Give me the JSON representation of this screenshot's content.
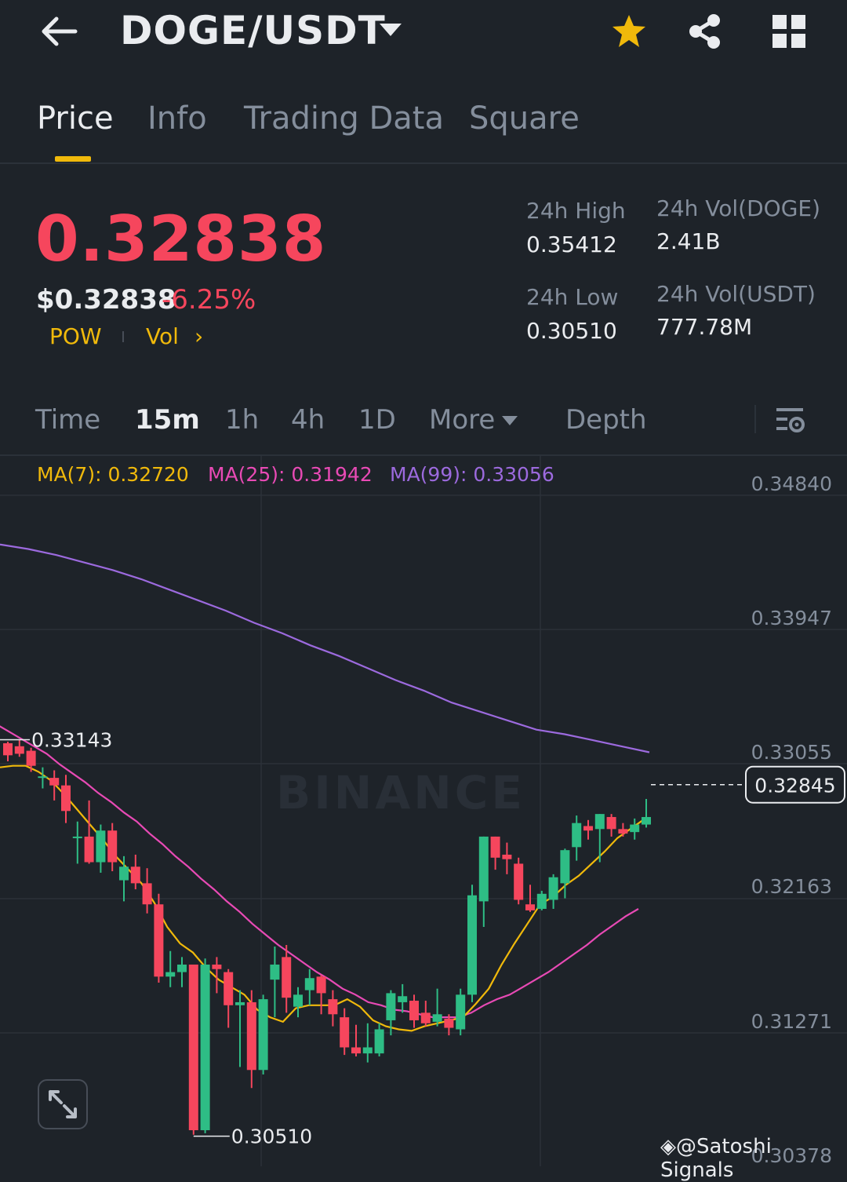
{
  "header": {
    "pair": "DOGE/USDT",
    "icons": [
      "back-arrow-icon",
      "chevron-down-icon",
      "star-icon",
      "share-icon",
      "grid-icon"
    ],
    "star_color": "#f0b90b"
  },
  "tabs": [
    {
      "label": "Price",
      "active": true
    },
    {
      "label": "Info",
      "active": false
    },
    {
      "label": "Trading Data",
      "active": false
    },
    {
      "label": "Square",
      "active": false
    }
  ],
  "ticker": {
    "last_price": "0.32838",
    "usd_price": "$0.32838",
    "change": "-6.25%",
    "tag_pow": "POW",
    "tag_vol": "Vol",
    "tag_arrow": "›",
    "high_label": "24h High",
    "high_value": "0.35412",
    "low_label": "24h Low",
    "low_value": "0.30510",
    "vol_doge_label": "24h Vol(DOGE)",
    "vol_doge_value": "2.41B",
    "vol_usdt_label": "24h Vol(USDT)",
    "vol_usdt_value": "777.78M",
    "down_color": "#f6465d",
    "up_color": "#2ebd85",
    "accent_color": "#f0b90b"
  },
  "intervals": {
    "time": "Time",
    "m15": "15m",
    "h1": "1h",
    "h4": "4h",
    "d1": "1D",
    "more": "More",
    "depth": "Depth",
    "active": "15m"
  },
  "indicators": {
    "ma7": "MA(7): 0.32720",
    "ma25": "MA(25): 0.31942",
    "ma99": "MA(99): 0.33056",
    "ma7_color": "#f0b90b",
    "ma25_color": "#e84ab5",
    "ma99_color": "#9c6ade"
  },
  "watermark": {
    "brand": "BINANCE",
    "credit": "@Satoshi Signals"
  },
  "chart_data": {
    "type": "candlestick",
    "y_axis_ticks": [
      "0.34840",
      "0.33947",
      "0.33055",
      "0.32163",
      "0.31271",
      "0.30378"
    ],
    "ylim": [
      0.30378,
      0.3484
    ],
    "current_price_label": "0.32845",
    "period_high_label": "0.33143",
    "period_low_label": "0.30510",
    "candles": [
      {
        "o": 0.3312,
        "h": 0.3313,
        "l": 0.33,
        "c": 0.3304
      },
      {
        "o": 0.331,
        "h": 0.3314,
        "l": 0.3303,
        "c": 0.3305
      },
      {
        "o": 0.3307,
        "h": 0.3309,
        "l": 0.3293,
        "c": 0.3297
      },
      {
        "o": 0.329,
        "h": 0.3296,
        "l": 0.3282,
        "c": 0.329
      },
      {
        "o": 0.3289,
        "h": 0.3294,
        "l": 0.3274,
        "c": 0.3284
      },
      {
        "o": 0.3284,
        "h": 0.3291,
        "l": 0.3259,
        "c": 0.3267
      },
      {
        "o": 0.325,
        "h": 0.326,
        "l": 0.3232,
        "c": 0.325
      },
      {
        "o": 0.325,
        "h": 0.3274,
        "l": 0.3232,
        "c": 0.3233
      },
      {
        "o": 0.3233,
        "h": 0.3258,
        "l": 0.3226,
        "c": 0.3254
      },
      {
        "o": 0.3254,
        "h": 0.3259,
        "l": 0.3227,
        "c": 0.3233
      },
      {
        "o": 0.3221,
        "h": 0.3237,
        "l": 0.3207,
        "c": 0.323
      },
      {
        "o": 0.323,
        "h": 0.3238,
        "l": 0.3215,
        "c": 0.3219
      },
      {
        "o": 0.3219,
        "h": 0.3229,
        "l": 0.3199,
        "c": 0.3205
      },
      {
        "o": 0.3205,
        "h": 0.3212,
        "l": 0.3153,
        "c": 0.3157
      },
      {
        "o": 0.3157,
        "h": 0.3174,
        "l": 0.315,
        "c": 0.316
      },
      {
        "o": 0.316,
        "h": 0.317,
        "l": 0.315,
        "c": 0.3165
      },
      {
        "o": 0.3165,
        "h": 0.3165,
        "l": 0.3052,
        "c": 0.3055
      },
      {
        "o": 0.3055,
        "h": 0.3169,
        "l": 0.3053,
        "c": 0.3165
      },
      {
        "o": 0.3165,
        "h": 0.317,
        "l": 0.3146,
        "c": 0.3162
      },
      {
        "o": 0.316,
        "h": 0.3162,
        "l": 0.3123,
        "c": 0.3138
      },
      {
        "o": 0.3138,
        "h": 0.3148,
        "l": 0.3097,
        "c": 0.314
      },
      {
        "o": 0.314,
        "h": 0.3148,
        "l": 0.3083,
        "c": 0.3095
      },
      {
        "o": 0.3095,
        "h": 0.3145,
        "l": 0.3092,
        "c": 0.3142
      },
      {
        "o": 0.3155,
        "h": 0.3177,
        "l": 0.313,
        "c": 0.3165
      },
      {
        "o": 0.317,
        "h": 0.3178,
        "l": 0.3133,
        "c": 0.3143
      },
      {
        "o": 0.3137,
        "h": 0.315,
        "l": 0.313,
        "c": 0.3145
      },
      {
        "o": 0.3148,
        "h": 0.3162,
        "l": 0.3138,
        "c": 0.3156
      },
      {
        "o": 0.3157,
        "h": 0.3158,
        "l": 0.3132,
        "c": 0.3146
      },
      {
        "o": 0.3142,
        "h": 0.3148,
        "l": 0.3124,
        "c": 0.3132
      },
      {
        "o": 0.313,
        "h": 0.3136,
        "l": 0.3105,
        "c": 0.311
      },
      {
        "o": 0.311,
        "h": 0.3125,
        "l": 0.3104,
        "c": 0.3106
      },
      {
        "o": 0.3106,
        "h": 0.3126,
        "l": 0.31,
        "c": 0.311
      },
      {
        "o": 0.3106,
        "h": 0.3126,
        "l": 0.3104,
        "c": 0.3122
      },
      {
        "o": 0.3128,
        "h": 0.3148,
        "l": 0.3118,
        "c": 0.3146
      },
      {
        "o": 0.314,
        "h": 0.3152,
        "l": 0.3133,
        "c": 0.3144
      },
      {
        "o": 0.3141,
        "h": 0.3145,
        "l": 0.3123,
        "c": 0.3128
      },
      {
        "o": 0.3133,
        "h": 0.3141,
        "l": 0.3124,
        "c": 0.3126
      },
      {
        "o": 0.3127,
        "h": 0.3149,
        "l": 0.3124,
        "c": 0.3132
      },
      {
        "o": 0.3129,
        "h": 0.3132,
        "l": 0.3118,
        "c": 0.3123
      },
      {
        "o": 0.3122,
        "h": 0.3149,
        "l": 0.3118,
        "c": 0.3145
      },
      {
        "o": 0.3145,
        "h": 0.3218,
        "l": 0.314,
        "c": 0.3211
      },
      {
        "o": 0.3207,
        "h": 0.325,
        "l": 0.319,
        "c": 0.325
      },
      {
        "o": 0.325,
        "h": 0.325,
        "l": 0.3228,
        "c": 0.3236
      },
      {
        "o": 0.3238,
        "h": 0.3246,
        "l": 0.3225,
        "c": 0.3235
      },
      {
        "o": 0.3232,
        "h": 0.3236,
        "l": 0.3205,
        "c": 0.3208
      },
      {
        "o": 0.3205,
        "h": 0.3218,
        "l": 0.32,
        "c": 0.3201
      },
      {
        "o": 0.3202,
        "h": 0.3214,
        "l": 0.3201,
        "c": 0.3212
      },
      {
        "o": 0.3208,
        "h": 0.3225,
        "l": 0.3202,
        "c": 0.3223
      },
      {
        "o": 0.3219,
        "h": 0.3242,
        "l": 0.3209,
        "c": 0.3241
      },
      {
        "o": 0.3243,
        "h": 0.3264,
        "l": 0.3234,
        "c": 0.3259
      },
      {
        "o": 0.3257,
        "h": 0.3261,
        "l": 0.3248,
        "c": 0.3254
      },
      {
        "o": 0.3255,
        "h": 0.3265,
        "l": 0.3233,
        "c": 0.3265
      },
      {
        "o": 0.3263,
        "h": 0.3265,
        "l": 0.325,
        "c": 0.3255
      },
      {
        "o": 0.3255,
        "h": 0.3259,
        "l": 0.325,
        "c": 0.3252
      },
      {
        "o": 0.3253,
        "h": 0.3262,
        "l": 0.3248,
        "c": 0.3258
      },
      {
        "o": 0.3258,
        "h": 0.3275,
        "l": 0.3256,
        "c": 0.3263
      }
    ],
    "ma7": [
      0.3296,
      0.3297,
      0.3297,
      0.3293,
      0.3287,
      0.3278,
      0.3268,
      0.3258,
      0.3248,
      0.3237,
      0.3228,
      0.3219,
      0.3206,
      0.319,
      0.3179,
      0.3173,
      0.3163,
      0.3155,
      0.315,
      0.3145,
      0.3135,
      0.313,
      0.3127,
      0.3136,
      0.3138,
      0.3138,
      0.3138,
      0.3142,
      0.3137,
      0.3128,
      0.3124,
      0.3122,
      0.3121,
      0.3124,
      0.3126,
      0.3128,
      0.313,
      0.3139,
      0.3149,
      0.3165,
      0.3179,
      0.3192,
      0.3205,
      0.321,
      0.3218,
      0.3224,
      0.3232,
      0.324,
      0.3249,
      0.3255,
      0.3261
    ],
    "ma25": [
      0.3325,
      0.332,
      0.3315,
      0.331,
      0.3305,
      0.3298,
      0.3292,
      0.3286,
      0.3279,
      0.3273,
      0.3266,
      0.326,
      0.3252,
      0.3245,
      0.3237,
      0.323,
      0.3222,
      0.3215,
      0.3207,
      0.32,
      0.3192,
      0.3185,
      0.3178,
      0.3172,
      0.3166,
      0.316,
      0.3155,
      0.3149,
      0.3145,
      0.314,
      0.3138,
      0.3135,
      0.3134,
      0.3132,
      0.313,
      0.313,
      0.313,
      0.3133,
      0.3138,
      0.3142,
      0.3145,
      0.315,
      0.3155,
      0.316,
      0.3166,
      0.3172,
      0.3178,
      0.3185,
      0.3191,
      0.3197,
      0.3202
    ],
    "ma99": [
      0.3444,
      0.3441,
      0.3437,
      0.3432,
      0.3427,
      0.3421,
      0.3414,
      0.3407,
      0.34,
      0.3392,
      0.3385,
      0.3377,
      0.337,
      0.3362,
      0.3354,
      0.3347,
      0.3339,
      0.3333,
      0.3327,
      0.3321,
      0.3318,
      0.3314,
      0.331,
      0.3306
    ]
  }
}
